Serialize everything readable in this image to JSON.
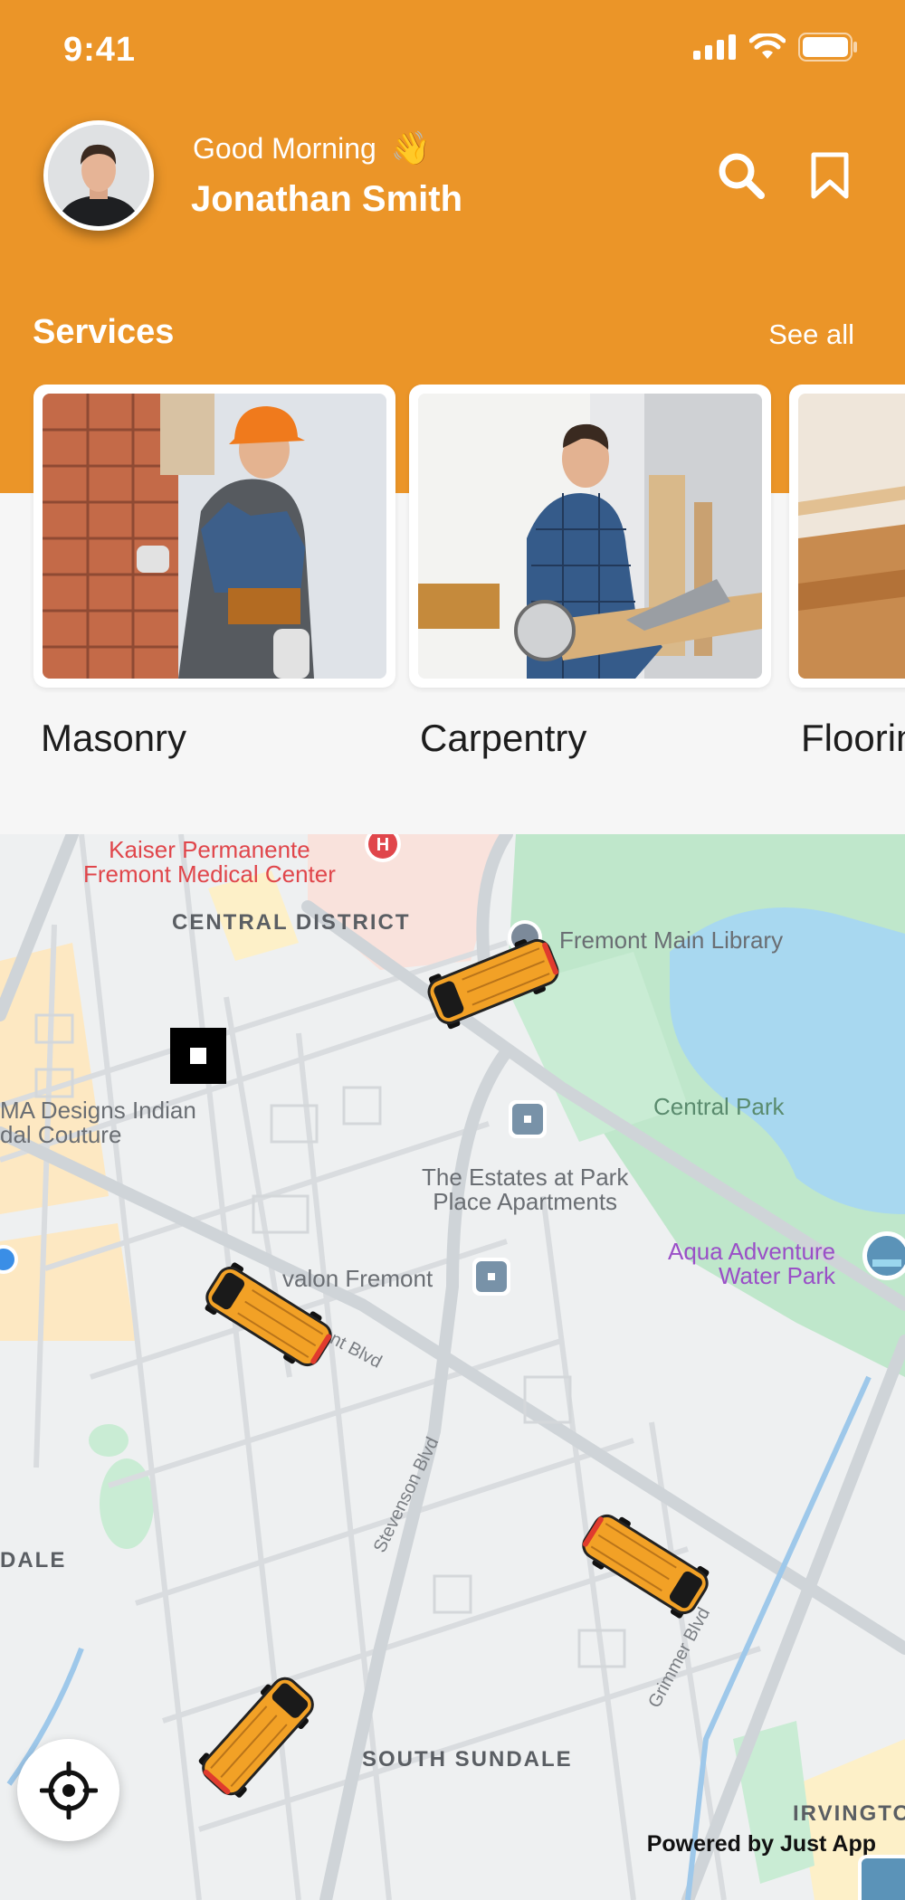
{
  "status_bar": {
    "time": "9:41"
  },
  "header": {
    "greeting": "Good Morning",
    "greeting_emoji": "👋",
    "user_name": "Jonathan Smith",
    "search_icon": "search-icon",
    "bookmark_icon": "bookmark-icon"
  },
  "services": {
    "title": "Services",
    "see_all": "See all",
    "items": [
      {
        "label": "Masonry"
      },
      {
        "label": "Carpentry"
      },
      {
        "label": "Floorin"
      }
    ]
  },
  "map": {
    "labels": {
      "kaiser": "Kaiser Permanente\nFremont Medical Center",
      "central_district": "CENTRAL DISTRICT",
      "library": "Fremont Main Library",
      "designs": "MA Designs Indian\ndal Couture",
      "central_park": "Central Park",
      "estates": "The Estates at Park\nPlace Apartments",
      "aqua": "Aqua Adventure\nWater Park",
      "avalon": "valon Fremont",
      "fremont_blvd": "ont Blvd",
      "stevenson": "Stevenson Blvd",
      "grimmer": "Grimmer Blvd",
      "dale": "DALE",
      "south_sundale": "SOUTH SUNDALE",
      "irvington": "IRVINGTO"
    },
    "powered_by": "Powered by Just App"
  },
  "colors": {
    "brand": "#eb9528",
    "car_body": "#f2a126",
    "water": "#9fd6f0",
    "park": "#b6e3c4"
  }
}
